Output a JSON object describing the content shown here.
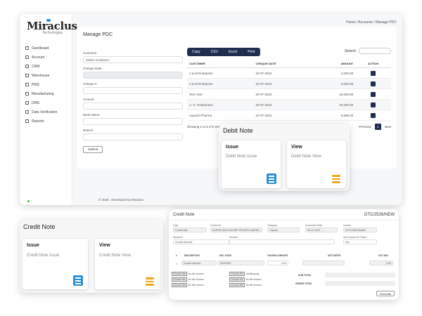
{
  "main": {
    "logo": {
      "name": "Miraclus",
      "sub": "Technologies"
    },
    "nav": [
      "Dashboard",
      "Account",
      "CRM",
      "Warehouse",
      "PMS",
      "Manufacturing",
      "DMS",
      "Data Verification",
      "Reports"
    ],
    "breadcrumb": "Home  /  Accounts  /  Manage PDC",
    "page_title": "Manage PDC",
    "form": {
      "customer_label": "Customer",
      "customer_value": "Select Customer",
      "cheque_date_label": "Cheque Date",
      "cheque_no_label": "Cheque #",
      "amount_label": "Amount",
      "bank_label": "Bank Name",
      "branch_label": "Branch",
      "submit_label": "Submit"
    },
    "export_buttons": [
      "Copy",
      "CSV",
      "Excel",
      "Print"
    ],
    "search_label": "Search:",
    "table": {
      "headers": [
        "CUSTOMER",
        "CHEQUE DATE",
        "AMOUNT",
        "ACTION"
      ],
      "rows": [
        [
          "A & M Enterprise",
          "18-07-2024",
          "2,000.00"
        ],
        [
          "A & M Enterprise",
          "22-07-2024",
          "6,000.00"
        ],
        [
          "Test User",
          "20-07-2024",
          "45,000.00"
        ],
        [
          "A. K. Enterprises",
          "20-07-2024",
          "20,000.00"
        ],
        [
          "Aayush Pharma",
          "22-07-2024",
          "8,699.00"
        ]
      ]
    },
    "showing": "Showing 1 to 5 of 5 entries",
    "pager": {
      "prev": "Previous",
      "current": "1",
      "next": "Next"
    },
    "footer": "© 2025 , Developed by Miraclus"
  },
  "debit_note": {
    "title": "Debit Note",
    "issue": {
      "title": "Issue",
      "sub": "Debit Note Issue"
    },
    "view": {
      "title": "View",
      "sub": "Debit Note View"
    }
  },
  "credit_note": {
    "title": "Credit Note",
    "issue": {
      "title": "Issue",
      "sub": "Credit Note Issue"
    },
    "view": {
      "title": "View",
      "sub": "Credit Note View"
    }
  },
  "cn_form": {
    "title": "Credit Note",
    "number": "GTC/2526/NEW",
    "type_label": "Type",
    "type_value": "Credit Note",
    "customer_label": "Customer",
    "customer_value": "AARON HEALTHCARE PRIVATE LIMITED",
    "category_label": "Category",
    "category_value": "Trauma",
    "docdate_label": "Document Date",
    "docdate_value": "05-11-2025",
    "invoice_label": "Invoice",
    "invoice_value": "GTC/2425/TA4659",
    "reasons_label": "Reasons",
    "reasons_value": "Goods returned",
    "remark_label": "Remark",
    "impact_label": "Has Impact On Sales",
    "impact_value": "Yes",
    "headers": [
      "#",
      "DESCRIPTION",
      "HSC CODE",
      "TAXABLE AMOUNT",
      "GST RATE%",
      "GST AMT"
    ],
    "row": {
      "no": "1",
      "desc": "Goods returned",
      "hsc": "90211000",
      "taxable": "0.00",
      "gst_amt": "0.00"
    },
    "file_btn": "Choose file",
    "no_file": "No file chosen",
    "file_selected": "Untitled.png",
    "sub_total_label": "SUB TOTAL",
    "grand_total_label": "GRAND TOTAL",
    "generate_label": "Generate"
  }
}
